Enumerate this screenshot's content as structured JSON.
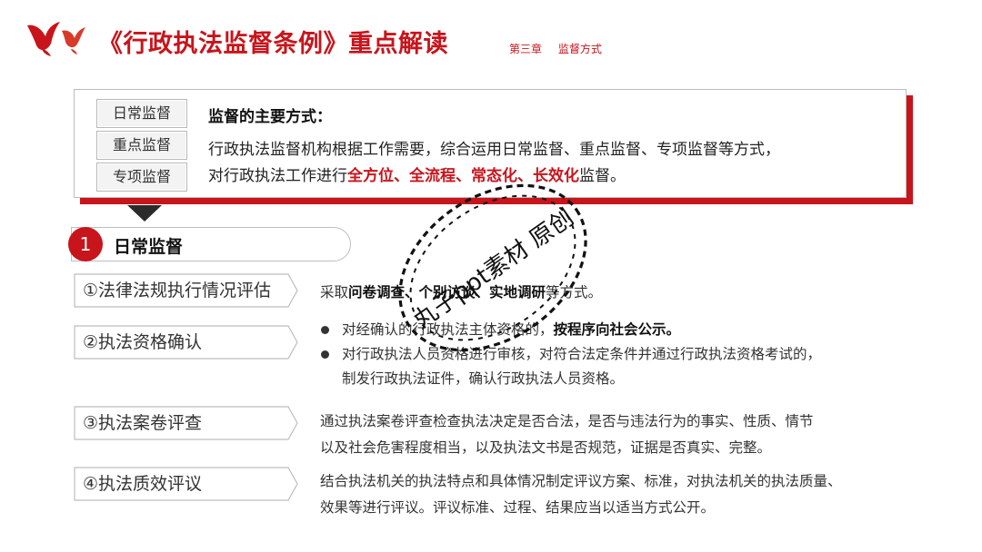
{
  "header": {
    "title": "《行政执法监督条例》重点解读",
    "chapter": "第三章",
    "chapter_name": "监督方式"
  },
  "summary": {
    "tags": [
      "日常监督",
      "重点监督",
      "专项监督"
    ],
    "heading": "监督的主要方式：",
    "line1": "行政执法监督机构根据工作需要，综合运用日常监督、重点监督、专项监督等方式，",
    "line2_prefix": "对行政执法工作进行",
    "line2_emphasis": "全方位、全流程、常态化、长效化",
    "line2_suffix": "监督。"
  },
  "section": {
    "number": "1",
    "title": "日常监督"
  },
  "items": [
    {
      "label": "①法律法规执行情况评估",
      "desc_prefix": "采取",
      "desc_bold": "问卷调查、个别访谈、实地调研",
      "desc_suffix": "等方式。"
    },
    {
      "label": "②执法资格确认",
      "bullet1_prefix": "对经确认的行政执法主体资格的，",
      "bullet1_bold": "按程序向社会公示。",
      "bullet2_line1": "对行政执法人员资格进行审核，对符合法定条件并通过行政执法资格考试的，",
      "bullet2_line2": "制发行政执法证件，确认行政执法人员资格。"
    },
    {
      "label": "③执法案卷评查",
      "line1": "通过执法案卷评查检查执法决定是否合法，是否与违法行为的事实、性质、情节",
      "line2": "以及社会危害程度相当，以及执法文书是否规范，证据是否真实、完整。"
    },
    {
      "label": "④执法质效评议",
      "line1": "结合执法机关的执法特点和具体情况制定评议方案、标准，对执法机关的执法质量、",
      "line2": "效果等进行评议。评议标准、过程、结果应当以适当方式公开。"
    }
  ],
  "watermark": {
    "text": "丸子ppt素材 原创"
  },
  "colors": {
    "accent": "#c8141b",
    "text": "#333333",
    "border": "#bdbdbd"
  }
}
